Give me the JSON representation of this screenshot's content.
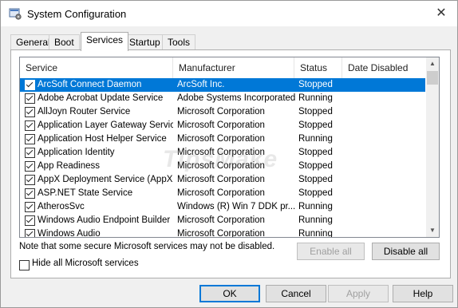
{
  "window": {
    "title": "System Configuration",
    "close_glyph": "✕"
  },
  "tabs": [
    {
      "label": "General"
    },
    {
      "label": "Boot"
    },
    {
      "label": "Services"
    },
    {
      "label": "Startup"
    },
    {
      "label": "Tools"
    }
  ],
  "table": {
    "headers": {
      "service": "Service",
      "manufacturer": "Manufacturer",
      "status": "Status",
      "date_disabled": "Date Disabled"
    },
    "rows": [
      {
        "service": "ArcSoft Connect Daemon",
        "manufacturer": "ArcSoft Inc.",
        "status": "Stopped",
        "date_disabled": "",
        "checked": true,
        "selected": true
      },
      {
        "service": "Adobe Acrobat Update Service",
        "manufacturer": "Adobe Systems Incorporated",
        "status": "Running",
        "date_disabled": "",
        "checked": true
      },
      {
        "service": "AllJoyn Router Service",
        "manufacturer": "Microsoft Corporation",
        "status": "Stopped",
        "date_disabled": "",
        "checked": true
      },
      {
        "service": "Application Layer Gateway Service",
        "manufacturer": "Microsoft Corporation",
        "status": "Stopped",
        "date_disabled": "",
        "checked": true
      },
      {
        "service": "Application Host Helper Service",
        "manufacturer": "Microsoft Corporation",
        "status": "Running",
        "date_disabled": "",
        "checked": true
      },
      {
        "service": "Application Identity",
        "manufacturer": "Microsoft Corporation",
        "status": "Stopped",
        "date_disabled": "",
        "checked": true
      },
      {
        "service": "App Readiness",
        "manufacturer": "Microsoft Corporation",
        "status": "Stopped",
        "date_disabled": "",
        "checked": true
      },
      {
        "service": "AppX Deployment Service (AppX...",
        "manufacturer": "Microsoft Corporation",
        "status": "Stopped",
        "date_disabled": "",
        "checked": true
      },
      {
        "service": "ASP.NET State Service",
        "manufacturer": "Microsoft Corporation",
        "status": "Stopped",
        "date_disabled": "",
        "checked": true
      },
      {
        "service": "AtherosSvc",
        "manufacturer": "Windows (R) Win 7 DDK pr...",
        "status": "Running",
        "date_disabled": "",
        "checked": true
      },
      {
        "service": "Windows Audio Endpoint Builder",
        "manufacturer": "Microsoft Corporation",
        "status": "Running",
        "date_disabled": "",
        "checked": true
      },
      {
        "service": "Windows Audio",
        "manufacturer": "Microsoft Corporation",
        "status": "Running",
        "date_disabled": "",
        "checked": true
      }
    ]
  },
  "note": "Note that some secure Microsoft services may not be disabled.",
  "enable_all": "Enable all",
  "disable_all": "Disable all",
  "hide_ms": "Hide all Microsoft services",
  "buttons": {
    "ok": "OK",
    "cancel": "Cancel",
    "apply": "Apply",
    "help": "Help"
  },
  "watermark": "TipsMake",
  "colors": {
    "selection": "#0078d7",
    "window_bg": "#f0f0f0",
    "default_button_border": "#0078d7"
  },
  "icons": {
    "app": "system-configuration-icon",
    "close": "close-icon",
    "scroll_up": "scroll-up-icon",
    "scroll_down": "scroll-down-icon"
  }
}
